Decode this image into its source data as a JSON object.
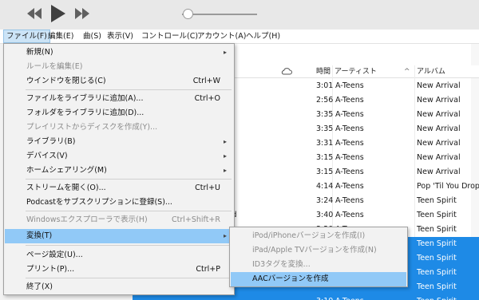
{
  "menubar": [
    {
      "label": "ファイル(F)",
      "active": true
    },
    {
      "label": "編集(E)"
    },
    {
      "label": "曲(S)"
    },
    {
      "label": "表示(V)"
    },
    {
      "label": "コントロール(C)"
    },
    {
      "label": "アカウント(A)"
    },
    {
      "label": "ヘルプ(H)"
    }
  ],
  "table": {
    "headers": {
      "time": "時間",
      "artist": "アーティスト",
      "album": "アルバム"
    },
    "sort_indicator": "^",
    "rows": [
      {
        "time": "3:01",
        "artist": "A-Teens",
        "album": "New Arrival",
        "selected": false
      },
      {
        "time": "2:56",
        "artist": "A-Teens",
        "album": "New Arrival",
        "selected": false
      },
      {
        "time": "3:35",
        "artist": "A-Teens",
        "album": "New Arrival",
        "selected": false
      },
      {
        "time": "3:35",
        "artist": "A-Teens",
        "album": "New Arrival",
        "selected": false
      },
      {
        "time": "3:31",
        "artist": "A-Teens",
        "album": "New Arrival",
        "selected": false
      },
      {
        "time": "3:15",
        "artist": "A-Teens",
        "album": "New Arrival",
        "selected": false
      },
      {
        "time": "3:15",
        "artist": "A-Teens",
        "album": "New Arrival",
        "selected": false
      },
      {
        "time": "4:14",
        "artist": "A-Teens",
        "album": "Pop 'Til You Drop",
        "selected": false
      },
      {
        "time": "3:24",
        "artist": "A-Teens",
        "album": "Teen Spirit",
        "selected": false
      },
      {
        "time": "3:40",
        "artist": "A-Teens",
        "album": "Teen Spirit",
        "selected": false,
        "title_fragment": "rld"
      },
      {
        "time": "3:20",
        "artist": "A-Teens",
        "album": "Teen Spirit",
        "selected": false
      },
      {
        "time": "",
        "artist": "",
        "album": "Teen Spirit",
        "selected": true
      },
      {
        "time": "",
        "artist": "",
        "album": "Teen Spirit",
        "selected": true
      },
      {
        "time": "",
        "artist": "",
        "album": "Teen Spirit",
        "selected": true
      },
      {
        "time": "",
        "artist": "",
        "album": "Teen Spirit",
        "selected": true
      },
      {
        "time": "3:10",
        "artist": "A-Teens",
        "album": "Teen Spirit",
        "selected": true
      }
    ]
  },
  "file_menu": {
    "items": [
      {
        "label": "新規(N)",
        "shortcut": "",
        "submenu": true,
        "disabled": false
      },
      {
        "label": "ルールを編集(E)",
        "shortcut": "",
        "submenu": false,
        "disabled": true
      },
      {
        "label": "ウインドウを閉じる(C)",
        "shortcut": "Ctrl+W",
        "submenu": false,
        "disabled": false
      },
      {
        "label": "ファイルをライブラリに追加(A)...",
        "shortcut": "Ctrl+O",
        "submenu": false,
        "disabled": false
      },
      {
        "label": "フォルダをライブラリに追加(D)...",
        "shortcut": "",
        "submenu": false,
        "disabled": false
      },
      {
        "label": "プレイリストからディスクを作成(Y)...",
        "shortcut": "",
        "submenu": false,
        "disabled": true
      },
      {
        "label": "ライブラリ(B)",
        "shortcut": "",
        "submenu": true,
        "disabled": false
      },
      {
        "label": "デバイス(V)",
        "shortcut": "",
        "submenu": true,
        "disabled": false
      },
      {
        "label": "ホームシェアリング(M)",
        "shortcut": "",
        "submenu": true,
        "disabled": false
      },
      {
        "label": "ストリームを開く(O)...",
        "shortcut": "Ctrl+U",
        "submenu": false,
        "disabled": false
      },
      {
        "label": "Podcastをサブスクリプションに登録(S)...",
        "shortcut": "",
        "submenu": false,
        "disabled": false
      },
      {
        "label": "Windowsエクスプローラで表示(H)",
        "shortcut": "Ctrl+Shift+R",
        "submenu": false,
        "disabled": true
      },
      {
        "label": "変換(T)",
        "shortcut": "",
        "submenu": true,
        "disabled": false,
        "highlighted": true
      },
      {
        "label": "ページ設定(U)...",
        "shortcut": "",
        "submenu": false,
        "disabled": false
      },
      {
        "label": "プリント(P)...",
        "shortcut": "Ctrl+P",
        "submenu": false,
        "disabled": false
      },
      {
        "label": "終了(X)",
        "shortcut": "",
        "submenu": false,
        "disabled": false
      }
    ]
  },
  "convert_submenu": {
    "items": [
      {
        "label": "iPod/iPhoneバージョンを作成(I)",
        "disabled": true
      },
      {
        "label": "iPad/Apple TVバージョンを作成(N)",
        "disabled": true
      },
      {
        "label": "ID3タグを変換...",
        "disabled": true
      },
      {
        "label": "AACバージョンを作成",
        "disabled": false,
        "highlighted": true
      }
    ]
  },
  "colors": {
    "menu_highlight": "#91c9f7",
    "selection": "#1e8ae6",
    "menubar_active": "#cce4f7"
  }
}
